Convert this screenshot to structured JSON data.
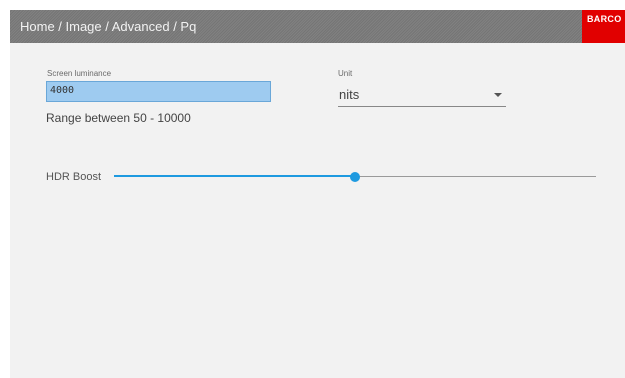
{
  "header": {
    "breadcrumb": "Home / Image / Advanced / Pq",
    "logo_text": "BARCO"
  },
  "screen_luminance": {
    "label": "Screen luminance",
    "value": "4000",
    "range_text": "Range between 50 - 10000"
  },
  "unit": {
    "label": "Unit",
    "selected": "nits"
  },
  "hdr_boost": {
    "label": "HDR Boost",
    "level_fraction": 0.5
  },
  "colors": {
    "accent": "#1e9ae0",
    "header_bg": "#7a7a7a",
    "logo_red": "#e10000",
    "input_highlight": "#9ecbf0"
  }
}
